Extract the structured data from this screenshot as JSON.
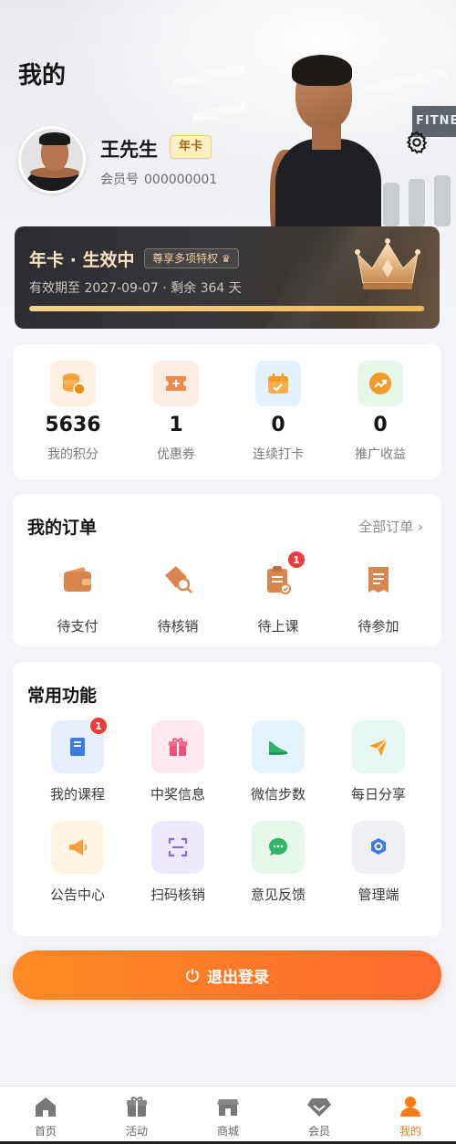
{
  "header": {
    "title": "我的",
    "user_name": "王先生",
    "membership_badge": "年卡",
    "member_no_label": "会员号",
    "member_no": "000000001"
  },
  "vip_card": {
    "title": "年卡 · 生效中",
    "privilege": "尊享多项特权",
    "expire": "有效期至 2027-09-07 · 剩余 364 天",
    "progress": 0.997
  },
  "stats": [
    {
      "value": "5636",
      "label": "我的积分",
      "icon": "coins-icon"
    },
    {
      "value": "1",
      "label": "优惠券",
      "icon": "coupon-icon"
    },
    {
      "value": "0",
      "label": "连续打卡",
      "icon": "calendar-check-icon"
    },
    {
      "value": "0",
      "label": "推广收益",
      "icon": "trend-up-icon"
    }
  ],
  "orders": {
    "title": "我的订单",
    "all_link": "全部订单",
    "items": [
      {
        "label": "待支付",
        "icon": "wallet-icon",
        "badge": ""
      },
      {
        "label": "待核销",
        "icon": "ticket-search-icon",
        "badge": ""
      },
      {
        "label": "待上课",
        "icon": "clipboard-check-icon",
        "badge": "1"
      },
      {
        "label": "待参加",
        "icon": "receipt-icon",
        "badge": ""
      }
    ]
  },
  "functions": {
    "title": "常用功能",
    "items": [
      {
        "label": "我的课程",
        "icon": "book-icon",
        "badge": "1"
      },
      {
        "label": "中奖信息",
        "icon": "gift-icon",
        "badge": ""
      },
      {
        "label": "微信步数",
        "icon": "shoe-icon",
        "badge": ""
      },
      {
        "label": "每日分享",
        "icon": "paper-plane-icon",
        "badge": ""
      },
      {
        "label": "公告中心",
        "icon": "megaphone-icon",
        "badge": ""
      },
      {
        "label": "扫码核销",
        "icon": "scan-icon",
        "badge": ""
      },
      {
        "label": "意见反馈",
        "icon": "chat-icon",
        "badge": ""
      },
      {
        "label": "管理端",
        "icon": "admin-gear-icon",
        "badge": ""
      }
    ]
  },
  "logout_label": "退出登录",
  "tabbar": [
    {
      "label": "首页",
      "icon": "home-icon"
    },
    {
      "label": "活动",
      "icon": "gift-box-icon"
    },
    {
      "label": "商城",
      "icon": "store-icon"
    },
    {
      "label": "会员",
      "icon": "diamond-icon"
    },
    {
      "label": "我的",
      "icon": "user-icon",
      "active": true
    }
  ],
  "colors": {
    "accent": "#ff7a1a",
    "badge_red": "#ee3b36",
    "card_gold": "#fbe3bf"
  }
}
